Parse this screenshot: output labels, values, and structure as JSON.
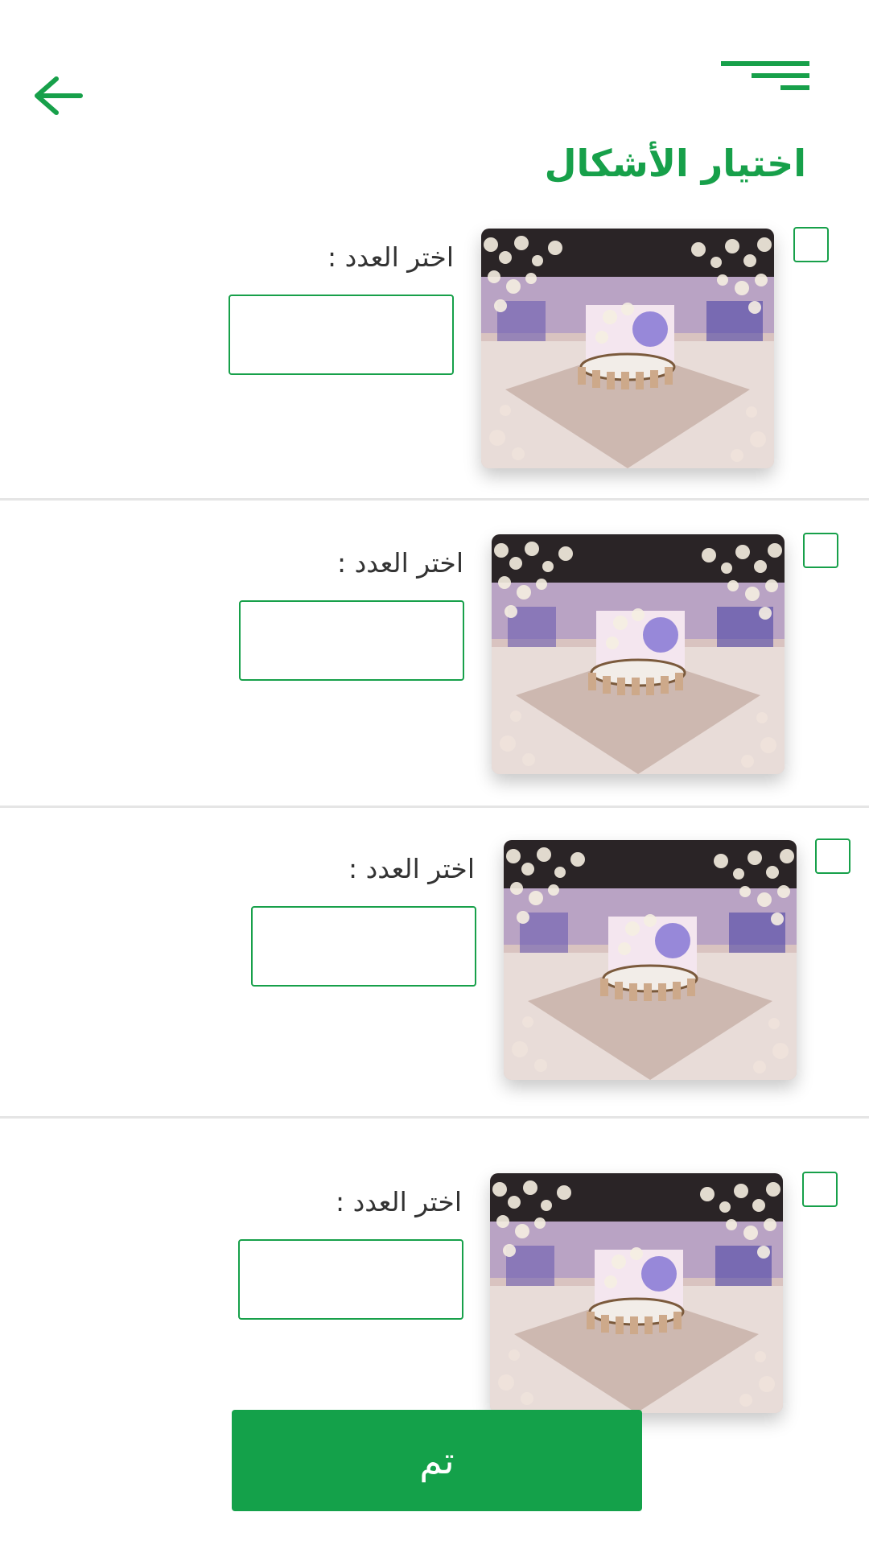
{
  "header": {
    "title": "اختيار الأشكال",
    "back_icon": "arrow-left-icon",
    "menu_icon": "hamburger-menu-icon"
  },
  "items": [
    {
      "count_label": "اختر العدد :",
      "count_value": "",
      "checked": false,
      "image": "wedding-hall-photo"
    },
    {
      "count_label": "اختر العدد :",
      "count_value": "",
      "checked": false,
      "image": "wedding-hall-photo"
    },
    {
      "count_label": "اختر العدد :",
      "count_value": "",
      "checked": false,
      "image": "wedding-hall-photo"
    },
    {
      "count_label": "اختر العدد :",
      "count_value": "",
      "checked": false,
      "image": "wedding-hall-photo"
    }
  ],
  "footer": {
    "done_label": "تم"
  },
  "colors": {
    "accent": "#17a04a",
    "button": "#14a14a",
    "divider": "#e5e5e5",
    "text": "#333333"
  }
}
